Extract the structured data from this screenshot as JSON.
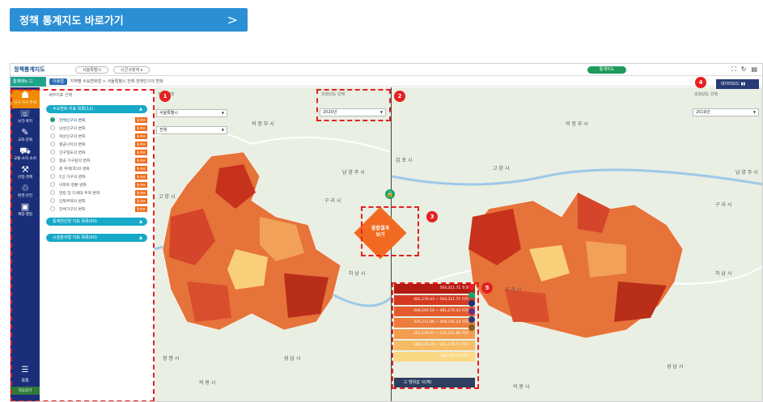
{
  "goto_button": {
    "label": "정책 통계지도 바로가기",
    "arrow": ">",
    "color": "#2b8fd6"
  },
  "app": {
    "brand": "정책통계지도",
    "region_pill": "서울특별시",
    "district_pill": "시군구분계 ▾",
    "center_button": "통계지도",
    "menu_label": "통계메뉴 ☷",
    "tag": "이용법",
    "breadcrumb": "지역별 수요변화형 > 서울특별시 전체 전체인구의 변화",
    "data_download": "데이터보드"
  },
  "sidebar": {
    "items": [
      {
        "icon": "person-icon",
        "label": "인구·가구·주택"
      },
      {
        "icon": "health-icon",
        "label": "보건·복지"
      },
      {
        "icon": "education-icon",
        "label": "교육·문화"
      },
      {
        "icon": "traffic-icon",
        "label": "교통·소득·소비"
      },
      {
        "icon": "industry-icon",
        "label": "산업·경제"
      },
      {
        "icon": "environment-icon",
        "label": "환경·안전"
      },
      {
        "icon": "finance-icon",
        "label": "재정·행정"
      }
    ],
    "list_label": "목록",
    "footer_label": "자동알기"
  },
  "panel": {
    "header": "세부지표 선택",
    "group1": "수요변화 지표 목록(12)",
    "group2": "통계연산형 지표 목록(00)",
    "group3": "시설분석형 지표 목록(00)",
    "chip": "통계표",
    "indicators": [
      "전체인구의 변화",
      "남성인구의 변화",
      "여성인구의 변화",
      "평균나이의 변화",
      "인구밀도의 변화",
      "평균 가구원의 변화",
      "총 주택(호)의 변화",
      "1인 가구의 변화",
      "아파트 현황 변화",
      "연립 및 다세대 주택 변화",
      "단독주택의 변화",
      "전체가구의 변화"
    ]
  },
  "left_map": {
    "region_label": "지역 선택",
    "region_value": "서울특별시",
    "district_value": "전체",
    "year_label": "조회년도 선택",
    "year_value": "2020년",
    "places": [
      "의 정 부 시",
      "고 양 시",
      "남 양 주 시",
      "구 리 시",
      "하 남 시",
      "성 남 시",
      "의 왕 시",
      "광 명 시"
    ]
  },
  "right_map": {
    "year_label": "조회년도 선택",
    "year_value": "2019년",
    "places": [
      "의 정 부 시",
      "고 양 시",
      "남 양 주 시",
      "김 포 시",
      "구 리 시",
      "하 남 시",
      "부 천 시",
      "성 남 시",
      "의 왕 시"
    ]
  },
  "fusion": {
    "line1": "융합결과",
    "line2": "보기"
  },
  "badges": [
    "1",
    "2",
    "3",
    "4",
    "5"
  ],
  "legend": {
    "rows": [
      {
        "text": "564,311.71 초과",
        "color": "#b41b13"
      },
      {
        "text": "481,276.43 ~ 564,311.71 이하",
        "color": "#d43a1f"
      },
      {
        "text": "408,245.14 ~ 481,276.43 이하",
        "color": "#e35b2c"
      },
      {
        "text": "335,211.86 ~ 408,245.14 이하",
        "color": "#ec7d3c"
      },
      {
        "text": "262,178.57 ~ 335,211.86 이하",
        "color": "#f39d4f"
      },
      {
        "text": "188,145.29 ~ 262,178.57 이하",
        "color": "#f7bb63"
      },
      {
        "text": "188,145.29 이하",
        "color": "#fbd883"
      }
    ],
    "swatches": [
      "#e6201f",
      "#1ea06b",
      "#1b2e7a",
      "#6b2d8a",
      "#283a74",
      "#8b5a1a"
    ],
    "footer": "범위값 사(재)"
  }
}
